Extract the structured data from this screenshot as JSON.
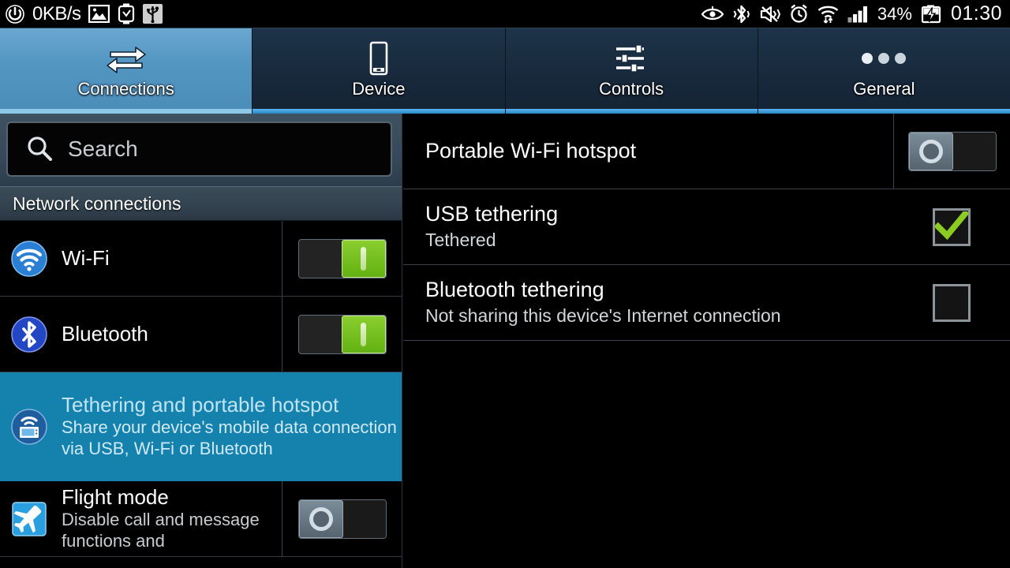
{
  "statusbar": {
    "left_icons": [
      "power-icon",
      "gallery-icon",
      "smartwatch-icon",
      "usb-icon"
    ],
    "data_rate": "0KB/s",
    "right_icons": [
      "smart-stay-eye-icon",
      "bluetooth-icon",
      "mute-vibrate-icon",
      "alarm-icon",
      "wifi-transfer-icon",
      "signal-bars-icon"
    ],
    "battery_percent": "34%",
    "battery_state_icon": "battery-charging-icon",
    "clock": "01:30"
  },
  "tabs": [
    {
      "label": "Connections",
      "icon": "transfer-arrows-icon",
      "active": true
    },
    {
      "label": "Device",
      "icon": "phone-icon",
      "active": false
    },
    {
      "label": "Controls",
      "icon": "sliders-icon",
      "active": false
    },
    {
      "label": "General",
      "icon": "three-dots-icon",
      "active": false
    }
  ],
  "sidebar": {
    "search": {
      "placeholder": "Search",
      "icon": "search-icon"
    },
    "section_header": "Network connections",
    "items": [
      {
        "title": "Wi-Fi",
        "subtitle": "",
        "icon": "wifi-icon",
        "control": "toggle",
        "state": "on",
        "selected": false
      },
      {
        "title": "Bluetooth",
        "subtitle": "",
        "icon": "bluetooth-icon",
        "control": "toggle",
        "state": "on",
        "selected": false
      },
      {
        "title": "Tethering and portable hotspot",
        "subtitle": "Share your device's mobile data connection via USB, Wi-Fi or Bluetooth",
        "icon": "hotspot-icon",
        "control": "none",
        "state": "",
        "selected": true
      },
      {
        "title": "Flight mode",
        "subtitle": "Disable call and message functions and",
        "icon": "airplane-icon",
        "control": "toggle",
        "state": "off",
        "selected": false
      }
    ]
  },
  "main": {
    "rows": [
      {
        "title": "Portable Wi-Fi hotspot",
        "subtitle": "",
        "control": "toggle",
        "state": "off"
      },
      {
        "title": "USB tethering",
        "subtitle": "Tethered",
        "control": "checkbox",
        "state": "checked"
      },
      {
        "title": "Bluetooth tethering",
        "subtitle": "Not sharing this device's Internet connection",
        "control": "checkbox",
        "state": "unchecked"
      }
    ]
  },
  "colors": {
    "accent_blue": "#1581ad",
    "tab_active": "#4b8cb8",
    "toggle_on_green": "#7ac119",
    "checkbox_check_green": "#8ccc22",
    "panel_bg": "#000000"
  }
}
